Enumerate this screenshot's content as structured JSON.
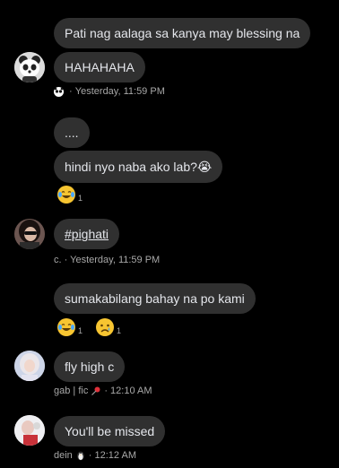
{
  "messages": {
    "m1": "Pati nag aalaga sa kanya may blessing na",
    "m2": "HAHAHAHA",
    "m2_meta": "Yesterday, 11:59 PM",
    "m3": "....",
    "m4": "hindi nyo naba ako lab?😭",
    "m4_react_count": "1",
    "m5": "#pighati",
    "m5_meta": "c. · Yesterday, 11:59 PM",
    "m6": "sumakabilang bahay na po kami",
    "m6_react_count_a": "1",
    "m6_react_count_b": "1",
    "m7": "fly high c",
    "m7_sender": "gab | fic",
    "m7_time": "· 12:10 AM",
    "m8": "You'll be missed",
    "m8_sender": "dein",
    "m8_time": "· 12:12 AM"
  },
  "icons": {
    "reaction_laugh": "face-with-tears-of-joy",
    "reaction_sad": "crying-face",
    "pin": "pushpin",
    "penguin": "penguin"
  }
}
